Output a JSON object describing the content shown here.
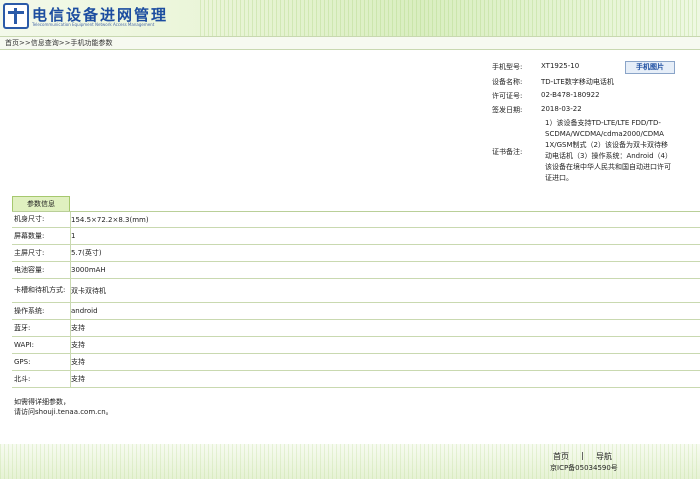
{
  "header": {
    "title": "电信设备进网管理",
    "subtitle": "Telecommunication Equipment Network Access Management"
  },
  "breadcrumb": "首页>>信息查询>>手机功能参数",
  "phone": {
    "model_label": "手机型号:",
    "model": "XT1925-10",
    "photo_button": "手机图片",
    "name_label": "设备名称:",
    "name": "TD-LTE数字移动电话机",
    "license_label": "许可证号:",
    "license": "02-B478-180922",
    "date_label": "签发日期:",
    "date": "2018-03-22",
    "remark_label": "证书备注:",
    "remark": "1）该设备支持TD-LTE/LTE FDD/TD-SCDMA/WCDMA/cdma2000/CDMA 1X/GSM制式（2）该设备为双卡双待移动电话机（3）操作系统：Android（4）该设备在境中华人民共和国自动进口许可证进口。"
  },
  "params": {
    "tab": "参数信息",
    "rows": [
      {
        "key": "机身尺寸:",
        "value": "154.5×72.2×8.3(mm)"
      },
      {
        "key": "屏幕数量:",
        "value": "1"
      },
      {
        "key": "主屏尺寸:",
        "value": "5.7(英寸)"
      },
      {
        "key": "电池容量:",
        "value": "3000mAH"
      },
      {
        "key": "卡槽和待机方式:",
        "value": "双卡双待机"
      },
      {
        "key": "操作系统:",
        "value": "android"
      },
      {
        "key": "蓝牙:",
        "value": "支持"
      },
      {
        "key": "WAPI:",
        "value": "支持"
      },
      {
        "key": "GPS:",
        "value": "支持"
      },
      {
        "key": "北斗:",
        "value": "支持"
      }
    ]
  },
  "note": {
    "line1": "如需得详细参数，",
    "line2": "请访问shouji.tenaa.com.cn。"
  },
  "footer": {
    "home": "首页",
    "sep": "|",
    "nav": "导航",
    "icp": "京ICP备05034590号"
  }
}
